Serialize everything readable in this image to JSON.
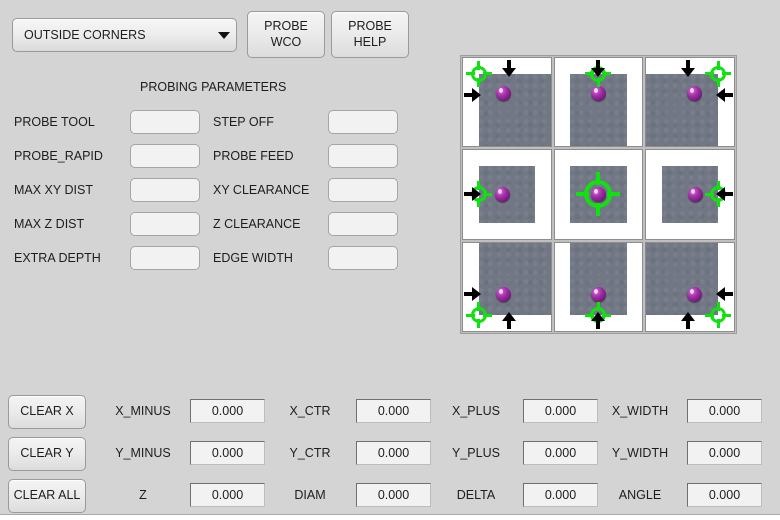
{
  "mode_select": {
    "name": "probe-mode-select",
    "value": "OUTSIDE CORNERS",
    "arrow_icon": "chevron-down-icon"
  },
  "toolbar": {
    "probe_wco_label": "PROBE\nWCO",
    "probe_help_label": "PROBE\nHELP"
  },
  "parameters": {
    "heading": "PROBING PARAMETERS",
    "left_column": [
      {
        "label": "PROBE TOOL",
        "value": ""
      },
      {
        "label": "PROBE_RAPID",
        "value": ""
      },
      {
        "label": "MAX XY DIST",
        "value": ""
      },
      {
        "label": "MAX Z DIST",
        "value": ""
      },
      {
        "label": "EXTRA DEPTH",
        "value": ""
      }
    ],
    "right_column": [
      {
        "label": "STEP OFF",
        "value": ""
      },
      {
        "label": "PROBE FEED",
        "value": ""
      },
      {
        "label": "XY CLEARANCE",
        "value": ""
      },
      {
        "label": "Z CLEARANCE",
        "value": ""
      },
      {
        "label": "EDGE WIDTH",
        "value": ""
      }
    ]
  },
  "probe_grid": {
    "name": "probe-position-grid",
    "cells": [
      {
        "name": "probe-cell-top-left",
        "corner": "top-left",
        "arrows": [
          "down",
          "right"
        ]
      },
      {
        "name": "probe-cell-top-center",
        "corner": "top-center",
        "arrows": [
          "down"
        ]
      },
      {
        "name": "probe-cell-top-right",
        "corner": "top-right",
        "arrows": [
          "down",
          "left"
        ]
      },
      {
        "name": "probe-cell-middle-left",
        "corner": "middle-left",
        "arrows": [
          "right"
        ]
      },
      {
        "name": "probe-cell-center",
        "corner": "center",
        "arrows": []
      },
      {
        "name": "probe-cell-middle-right",
        "corner": "middle-right",
        "arrows": [
          "left"
        ]
      },
      {
        "name": "probe-cell-bottom-left",
        "corner": "bottom-left",
        "arrows": [
          "right",
          "up"
        ]
      },
      {
        "name": "probe-cell-bottom-center",
        "corner": "bottom-center",
        "arrows": [
          "up"
        ]
      },
      {
        "name": "probe-cell-bottom-right",
        "corner": "bottom-right",
        "arrows": [
          "left",
          "up"
        ]
      }
    ]
  },
  "clear_buttons": [
    {
      "name": "clear-x-button",
      "label": "CLEAR X"
    },
    {
      "name": "clear-y-button",
      "label": "CLEAR Y"
    },
    {
      "name": "clear-all-button",
      "label": "CLEAR ALL"
    }
  ],
  "results": {
    "rows": [
      [
        {
          "label": "X_MINUS",
          "value": "0.000"
        },
        {
          "label": "X_CTR",
          "value": "0.000"
        },
        {
          "label": "X_PLUS",
          "value": "0.000"
        },
        {
          "label": "X_WIDTH",
          "value": "0.000"
        }
      ],
      [
        {
          "label": "Y_MINUS",
          "value": "0.000"
        },
        {
          "label": "Y_CTR",
          "value": "0.000"
        },
        {
          "label": "Y_PLUS",
          "value": "0.000"
        },
        {
          "label": "Y_WIDTH",
          "value": "0.000"
        }
      ],
      [
        {
          "label": "Z",
          "value": "0.000"
        },
        {
          "label": "DIAM",
          "value": "0.000"
        },
        {
          "label": "DELTA",
          "value": "0.000"
        },
        {
          "label": "ANGLE",
          "value": "0.000"
        }
      ]
    ]
  },
  "colors": {
    "background": "#d4d4d4",
    "crosshair_green": "#11e011",
    "probe_tip_purple": "#a32fa8",
    "material_gray": "#717784",
    "field_background": "#f2f2f2"
  }
}
